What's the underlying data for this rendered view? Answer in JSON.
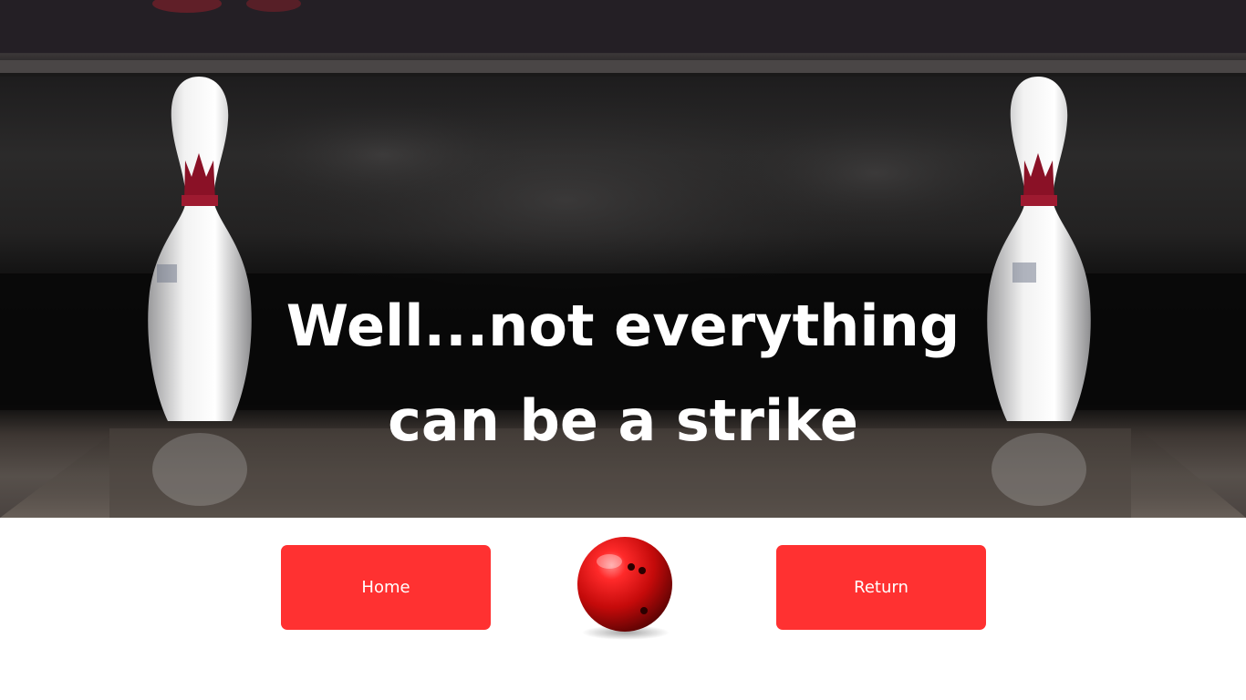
{
  "hero": {
    "image": "bowling-pins-photo",
    "headline_line1": "Well...not everything",
    "headline_line2": "can be a strike"
  },
  "actions": {
    "home_label": "Home",
    "return_label": "Return",
    "button_color": "#ff3131"
  },
  "decor": {
    "ball_icon": "bowling-ball-icon",
    "ball_color": "#d81010"
  }
}
